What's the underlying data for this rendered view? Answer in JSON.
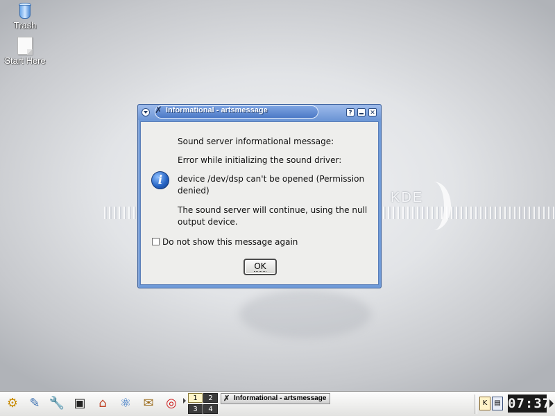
{
  "desktop": {
    "icons": [
      {
        "label": "Trash",
        "icon": "trash-icon"
      },
      {
        "label": "Start Here",
        "icon": "document-icon"
      }
    ],
    "wallpaper_text": "KDE"
  },
  "dialog": {
    "title": "Informational - artsmessage",
    "title_buttons": {
      "help": "?",
      "minimize": "",
      "close": "✕"
    },
    "lines": [
      "Sound server informational message:",
      "Error while initializing the sound driver:",
      "device /dev/dsp can't be opened (Permission denied)",
      "The sound server will continue, using the null output device."
    ],
    "info_glyph": "i",
    "checkbox_label": "Do not show this message again",
    "checkbox_checked": false,
    "ok_label": "OK",
    "colors": {
      "titlebar": "#6d96d6",
      "frame": "#3b5f9a",
      "client": "#eeeeec"
    }
  },
  "taskbar": {
    "launchers": [
      {
        "name": "kmenu",
        "glyph": "⚙"
      },
      {
        "name": "desktop",
        "glyph": "✎"
      },
      {
        "name": "control-center",
        "glyph": "🔧"
      },
      {
        "name": "terminal",
        "glyph": "▣"
      },
      {
        "name": "home",
        "glyph": "⌂"
      },
      {
        "name": "konqueror",
        "glyph": "⚛"
      },
      {
        "name": "kmail",
        "glyph": "✉"
      },
      {
        "name": "help",
        "glyph": "◎"
      }
    ],
    "pager": [
      "1",
      "2",
      "3",
      "4"
    ],
    "active_desktop": "1",
    "task": "Informational - artsmessage",
    "clock": "07:37"
  }
}
